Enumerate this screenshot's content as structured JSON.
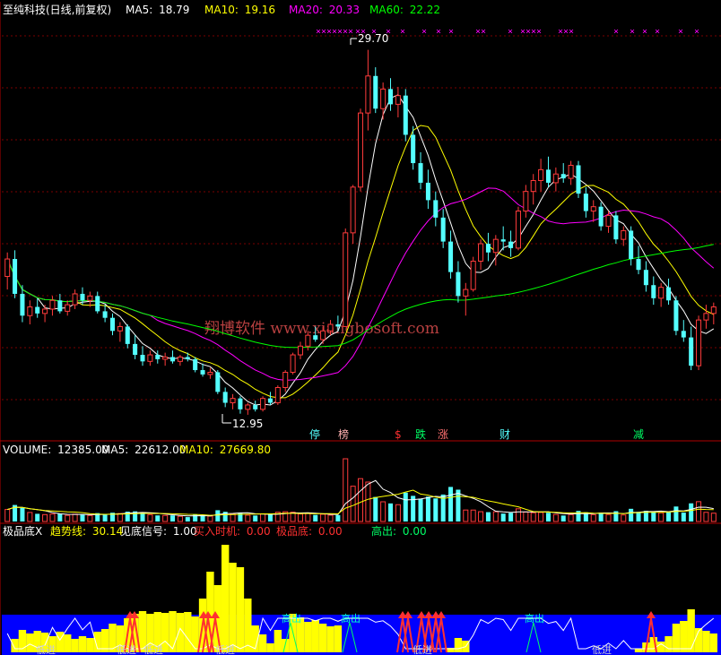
{
  "colors": {
    "background": "#000000",
    "candle_up": "#ff3b3b",
    "candle_down": "#54ffff",
    "ma5": "#ffffff",
    "ma10": "#ffff00",
    "ma20": "#ff00ff",
    "ma60": "#00ff00",
    "grid": "#7a0000",
    "volume_band": "#0000ff",
    "indicator_yellow": "#ffff00",
    "signal_red": "#ff3030",
    "signal_green": "#00ff66",
    "watermark": "#b84040"
  },
  "main_panel": {
    "title": "至纯科技(日线,前复权)",
    "ma5_label": "MA5:",
    "ma5_value": "18.79",
    "ma10_label": "MA10:",
    "ma10_value": "19.16",
    "ma20_label": "MA20:",
    "ma20_value": "20.33",
    "ma60_label": "MA60:",
    "ma60_value": "22.22",
    "high_label": "29.70",
    "low_label": "12.95",
    "watermark": "翔博软件  www.xiangbosoft.com",
    "event_tags": [
      {
        "text": "停",
        "color": "#54ffff"
      },
      {
        "text": "榜",
        "color": "#ffb0b0"
      },
      {
        "text": "$",
        "color": "#ff3030"
      },
      {
        "text": "跌",
        "color": "#00ff66"
      },
      {
        "text": "涨",
        "color": "#ff7070"
      },
      {
        "text": "财",
        "color": "#54ffff"
      },
      {
        "text": "减",
        "color": "#00ff66"
      }
    ]
  },
  "volume_panel": {
    "label": "VOLUME:",
    "value": "12385.00",
    "ma5_label": "MA5:",
    "ma5_value": "22612.00",
    "ma10_label": "MA10:",
    "ma10_value": "27669.80"
  },
  "indicator_panel": {
    "name": "极品底X",
    "trend_label": "趋势线:",
    "trend_value": "30.14",
    "bottom_signal_label": "见底信号:",
    "bottom_signal_value": "1.00",
    "buy_label": "买入时机:",
    "buy_value": "0.00",
    "best_bottom_label": "极品底:",
    "best_bottom_value": "0.00",
    "high_exit_label": "高出:",
    "high_exit_value": "0.00",
    "marker_labels": [
      "低进",
      "高出"
    ]
  },
  "chart_data": {
    "type": "candlestick",
    "title": "至纯科技(日线,前复权)",
    "price_high": 29.7,
    "price_low": 12.95,
    "ylim": [
      12,
      31
    ],
    "candles": [
      {
        "o": 19.3,
        "h": 20.4,
        "l": 18.7,
        "c": 20.1
      },
      {
        "o": 20.1,
        "h": 20.5,
        "l": 18.3,
        "c": 18.5
      },
      {
        "o": 18.5,
        "h": 18.9,
        "l": 17.2,
        "c": 17.5
      },
      {
        "o": 17.5,
        "h": 18.2,
        "l": 17.1,
        "c": 17.9
      },
      {
        "o": 17.9,
        "h": 18.3,
        "l": 17.4,
        "c": 17.6
      },
      {
        "o": 17.6,
        "h": 18.0,
        "l": 17.2,
        "c": 17.8
      },
      {
        "o": 17.8,
        "h": 18.4,
        "l": 17.5,
        "c": 18.2
      },
      {
        "o": 18.2,
        "h": 18.5,
        "l": 17.6,
        "c": 17.7
      },
      {
        "o": 17.7,
        "h": 18.2,
        "l": 17.5,
        "c": 18.0
      },
      {
        "o": 18.0,
        "h": 18.7,
        "l": 17.8,
        "c": 18.5
      },
      {
        "o": 18.5,
        "h": 18.8,
        "l": 18.0,
        "c": 18.2
      },
      {
        "o": 18.2,
        "h": 18.6,
        "l": 17.9,
        "c": 18.4
      },
      {
        "o": 18.4,
        "h": 18.6,
        "l": 17.6,
        "c": 17.7
      },
      {
        "o": 17.7,
        "h": 18.0,
        "l": 17.2,
        "c": 17.4
      },
      {
        "o": 17.4,
        "h": 17.6,
        "l": 16.6,
        "c": 16.8
      },
      {
        "o": 16.8,
        "h": 17.2,
        "l": 16.3,
        "c": 17.0
      },
      {
        "o": 17.0,
        "h": 17.1,
        "l": 16.0,
        "c": 16.2
      },
      {
        "o": 16.2,
        "h": 16.6,
        "l": 15.5,
        "c": 15.7
      },
      {
        "o": 15.7,
        "h": 16.1,
        "l": 15.2,
        "c": 15.4
      },
      {
        "o": 15.4,
        "h": 15.9,
        "l": 15.2,
        "c": 15.7
      },
      {
        "o": 15.7,
        "h": 15.9,
        "l": 15.3,
        "c": 15.5
      },
      {
        "o": 15.5,
        "h": 15.8,
        "l": 15.2,
        "c": 15.6
      },
      {
        "o": 15.6,
        "h": 15.9,
        "l": 15.3,
        "c": 15.4
      },
      {
        "o": 15.4,
        "h": 15.7,
        "l": 15.2,
        "c": 15.6
      },
      {
        "o": 15.6,
        "h": 15.8,
        "l": 15.4,
        "c": 15.5
      },
      {
        "o": 15.5,
        "h": 15.6,
        "l": 14.9,
        "c": 15.0
      },
      {
        "o": 15.0,
        "h": 15.3,
        "l": 14.7,
        "c": 14.8
      },
      {
        "o": 14.8,
        "h": 15.1,
        "l": 14.6,
        "c": 14.9
      },
      {
        "o": 14.9,
        "h": 15.0,
        "l": 13.9,
        "c": 14.0
      },
      {
        "o": 14.0,
        "h": 14.2,
        "l": 13.3,
        "c": 13.5
      },
      {
        "o": 13.5,
        "h": 13.9,
        "l": 13.2,
        "c": 13.7
      },
      {
        "o": 13.7,
        "h": 13.8,
        "l": 13.0,
        "c": 13.2
      },
      {
        "o": 13.2,
        "h": 13.5,
        "l": 12.95,
        "c": 13.4
      },
      {
        "o": 13.4,
        "h": 13.6,
        "l": 13.1,
        "c": 13.2
      },
      {
        "o": 13.2,
        "h": 13.8,
        "l": 13.1,
        "c": 13.7
      },
      {
        "o": 13.7,
        "h": 14.0,
        "l": 13.4,
        "c": 13.5
      },
      {
        "o": 13.5,
        "h": 14.3,
        "l": 13.4,
        "c": 14.2
      },
      {
        "o": 14.2,
        "h": 15.0,
        "l": 14.0,
        "c": 14.9
      },
      {
        "o": 14.9,
        "h": 15.8,
        "l": 14.8,
        "c": 15.7
      },
      {
        "o": 15.7,
        "h": 16.3,
        "l": 15.5,
        "c": 16.1
      },
      {
        "o": 16.1,
        "h": 16.8,
        "l": 15.9,
        "c": 16.6
      },
      {
        "o": 16.6,
        "h": 17.0,
        "l": 16.3,
        "c": 16.4
      },
      {
        "o": 16.4,
        "h": 17.0,
        "l": 16.2,
        "c": 16.8
      },
      {
        "o": 16.8,
        "h": 17.3,
        "l": 16.6,
        "c": 17.1
      },
      {
        "o": 17.1,
        "h": 17.5,
        "l": 16.8,
        "c": 17.0
      },
      {
        "o": 17.0,
        "h": 21.5,
        "l": 17.0,
        "c": 21.3
      },
      {
        "o": 21.3,
        "h": 23.5,
        "l": 20.8,
        "c": 23.4
      },
      {
        "o": 23.4,
        "h": 27.0,
        "l": 23.2,
        "c": 26.8
      },
      {
        "o": 26.8,
        "h": 29.7,
        "l": 26.0,
        "c": 28.5
      },
      {
        "o": 28.5,
        "h": 28.9,
        "l": 26.8,
        "c": 27.0
      },
      {
        "o": 27.0,
        "h": 28.2,
        "l": 26.5,
        "c": 27.9
      },
      {
        "o": 27.9,
        "h": 28.4,
        "l": 26.9,
        "c": 27.2
      },
      {
        "o": 27.2,
        "h": 28.0,
        "l": 26.6,
        "c": 27.6
      },
      {
        "o": 27.6,
        "h": 27.9,
        "l": 25.5,
        "c": 25.8
      },
      {
        "o": 25.8,
        "h": 26.2,
        "l": 24.2,
        "c": 24.5
      },
      {
        "o": 24.5,
        "h": 25.0,
        "l": 23.3,
        "c": 23.6
      },
      {
        "o": 23.6,
        "h": 24.2,
        "l": 22.4,
        "c": 22.8
      },
      {
        "o": 22.8,
        "h": 23.2,
        "l": 21.6,
        "c": 22.0
      },
      {
        "o": 22.0,
        "h": 22.4,
        "l": 20.6,
        "c": 20.9
      },
      {
        "o": 20.9,
        "h": 21.4,
        "l": 19.2,
        "c": 19.5
      },
      {
        "o": 19.5,
        "h": 20.0,
        "l": 18.1,
        "c": 18.4
      },
      {
        "o": 18.4,
        "h": 19.0,
        "l": 17.5,
        "c": 18.7
      },
      {
        "o": 18.7,
        "h": 20.2,
        "l": 18.6,
        "c": 20.0
      },
      {
        "o": 20.0,
        "h": 21.0,
        "l": 19.6,
        "c": 20.8
      },
      {
        "o": 20.8,
        "h": 21.3,
        "l": 20.0,
        "c": 20.4
      },
      {
        "o": 20.4,
        "h": 21.2,
        "l": 19.8,
        "c": 21.0
      },
      {
        "o": 21.0,
        "h": 21.6,
        "l": 20.5,
        "c": 20.9
      },
      {
        "o": 20.9,
        "h": 21.4,
        "l": 20.2,
        "c": 20.6
      },
      {
        "o": 20.6,
        "h": 22.5,
        "l": 20.5,
        "c": 22.3
      },
      {
        "o": 22.3,
        "h": 23.5,
        "l": 22.0,
        "c": 23.2
      },
      {
        "o": 23.2,
        "h": 24.0,
        "l": 22.6,
        "c": 23.7
      },
      {
        "o": 23.7,
        "h": 24.7,
        "l": 23.2,
        "c": 24.2
      },
      {
        "o": 24.2,
        "h": 24.8,
        "l": 23.4,
        "c": 23.6
      },
      {
        "o": 23.6,
        "h": 24.3,
        "l": 23.2,
        "c": 24.0
      },
      {
        "o": 24.0,
        "h": 24.5,
        "l": 23.6,
        "c": 23.8
      },
      {
        "o": 23.8,
        "h": 24.6,
        "l": 23.5,
        "c": 24.4
      },
      {
        "o": 24.4,
        "h": 24.6,
        "l": 22.9,
        "c": 23.1
      },
      {
        "o": 23.1,
        "h": 23.4,
        "l": 22.0,
        "c": 22.3
      },
      {
        "o": 22.3,
        "h": 22.8,
        "l": 21.8,
        "c": 22.5
      },
      {
        "o": 22.5,
        "h": 22.7,
        "l": 21.4,
        "c": 21.6
      },
      {
        "o": 21.6,
        "h": 22.3,
        "l": 21.3,
        "c": 22.1
      },
      {
        "o": 22.1,
        "h": 22.3,
        "l": 20.8,
        "c": 21.0
      },
      {
        "o": 21.0,
        "h": 21.6,
        "l": 20.7,
        "c": 21.4
      },
      {
        "o": 21.4,
        "h": 21.6,
        "l": 19.8,
        "c": 20.1
      },
      {
        "o": 20.1,
        "h": 20.7,
        "l": 19.4,
        "c": 19.6
      },
      {
        "o": 19.6,
        "h": 20.0,
        "l": 18.6,
        "c": 18.9
      },
      {
        "o": 18.9,
        "h": 19.3,
        "l": 18.0,
        "c": 18.3
      },
      {
        "o": 18.3,
        "h": 19.0,
        "l": 17.9,
        "c": 18.8
      },
      {
        "o": 18.8,
        "h": 19.2,
        "l": 18.0,
        "c": 18.2
      },
      {
        "o": 18.2,
        "h": 18.4,
        "l": 16.6,
        "c": 16.8
      },
      {
        "o": 16.8,
        "h": 17.3,
        "l": 16.3,
        "c": 16.5
      },
      {
        "o": 16.5,
        "h": 17.0,
        "l": 15.0,
        "c": 15.2
      },
      {
        "o": 15.2,
        "h": 17.5,
        "l": 15.0,
        "c": 17.3
      },
      {
        "o": 17.3,
        "h": 18.0,
        "l": 16.9,
        "c": 17.6
      },
      {
        "o": 17.6,
        "h": 18.1,
        "l": 17.1,
        "c": 17.9
      }
    ]
  }
}
